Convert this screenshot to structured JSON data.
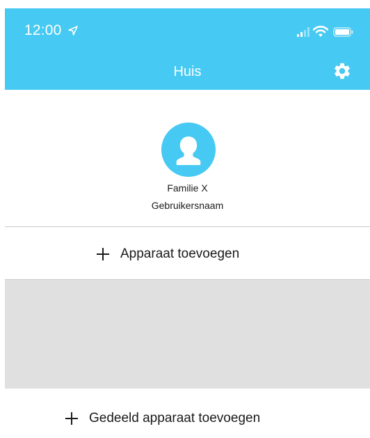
{
  "status_bar": {
    "time": "12:00"
  },
  "header": {
    "title": "Huis"
  },
  "profile": {
    "name": "Familie X",
    "username": "Gebruikersnaam"
  },
  "actions": {
    "add_device_label": "Apparaat toevoegen",
    "add_shared_device_label": "Gedeeld apparaat toevoegen"
  },
  "icons": {
    "location": "location-arrow-icon",
    "signal": "cellular-signal-icon",
    "wifi": "wifi-icon",
    "battery": "battery-icon",
    "settings": "gear-icon",
    "avatar": "user-silhouette-icon",
    "add": "plus-icon"
  },
  "colors": {
    "accent": "#46c9f2",
    "device_area_bg": "#e0e0e0",
    "divider": "#c8c8c8",
    "text": "#1a1a1a"
  }
}
